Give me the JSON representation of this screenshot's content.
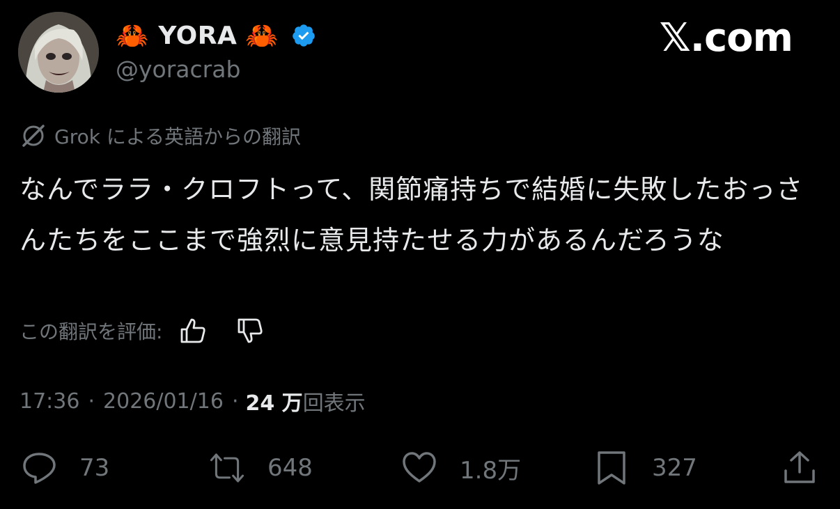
{
  "author": {
    "crab_left": "🦀",
    "display_name": "YORA",
    "crab_right": "🦀",
    "handle": "@yoracrab",
    "verified_color": "#1d9bf0"
  },
  "brand": {
    "site": "𝕏.com"
  },
  "translation": {
    "label": "Grok による英語からの翻訳",
    "rate_label": "この翻訳を評価:"
  },
  "post": {
    "text": "なんでララ・クロフトって、関節痛持ちで結婚に失敗したおっさんたちをここまで強烈に意見持たせる力があるんだろうな",
    "time": "17:36",
    "separator": "·",
    "date": "2026/01/16",
    "views_count": "24 万",
    "views_label": "回表示"
  },
  "actions": {
    "replies": "73",
    "reposts": "648",
    "likes": "1.8万",
    "bookmarks": "327"
  }
}
